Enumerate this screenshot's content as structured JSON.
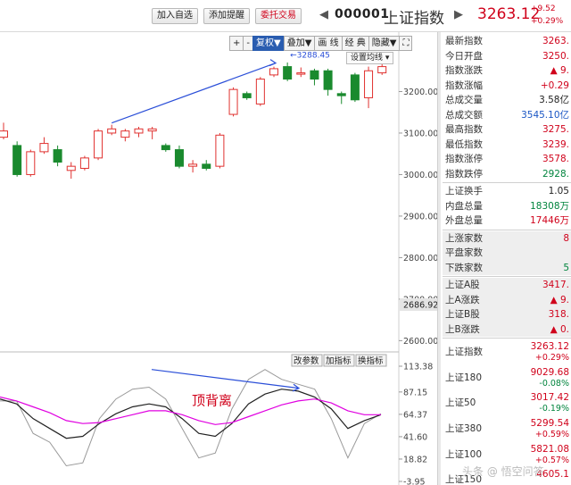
{
  "topbar": {
    "add_watchlist": "加入自选",
    "add_alert": "添加提醒",
    "trade": "委托交易",
    "code": "000001",
    "name": "上证指数",
    "price": "3263.12",
    "change": "+9.52",
    "change_pct": "+0.29%"
  },
  "toolbar": {
    "plus": "+",
    "minus": "-",
    "restore": "复权▼",
    "overlay": "叠加▼",
    "draw": "画 线",
    "classic": "经 典",
    "hide": "隐藏▼",
    "expand": "⛶",
    "ma_settings": "设置均线 ▾"
  },
  "chart_data": [
    {
      "type": "candlestick",
      "title": "",
      "y_ticks": [
        3200.0,
        3100.0,
        3000.0,
        2900.0,
        2800.0,
        2700.0,
        2600.0
      ],
      "y_highlight": "2686.92",
      "ylim": [
        2575,
        3300
      ],
      "annotation": "3288.45",
      "candles": [
        {
          "o": 3090,
          "c": 3105,
          "h": 3125,
          "l": 3085
        },
        {
          "o": 3070,
          "c": 3000,
          "h": 3080,
          "l": 2995
        },
        {
          "o": 3000,
          "c": 3055,
          "h": 3060,
          "l": 2995
        },
        {
          "o": 3055,
          "c": 3075,
          "h": 3090,
          "l": 3050
        },
        {
          "o": 3060,
          "c": 3030,
          "h": 3070,
          "l": 3020
        },
        {
          "o": 3010,
          "c": 3020,
          "h": 3030,
          "l": 2990
        },
        {
          "o": 3015,
          "c": 3040,
          "h": 3045,
          "l": 3010
        },
        {
          "o": 3040,
          "c": 3105,
          "h": 3110,
          "l": 3035
        },
        {
          "o": 3100,
          "c": 3110,
          "h": 3120,
          "l": 3095
        },
        {
          "o": 3090,
          "c": 3105,
          "h": 3110,
          "l": 3080
        },
        {
          "o": 3100,
          "c": 3110,
          "h": 3115,
          "l": 3090
        },
        {
          "o": 3105,
          "c": 3110,
          "h": 3115,
          "l": 3085
        },
        {
          "o": 3070,
          "c": 3060,
          "h": 3075,
          "l": 3055
        },
        {
          "o": 3060,
          "c": 3020,
          "h": 3070,
          "l": 3015
        },
        {
          "o": 3020,
          "c": 3025,
          "h": 3035,
          "l": 3005
        },
        {
          "o": 3025,
          "c": 3015,
          "h": 3035,
          "l": 3010
        },
        {
          "o": 3020,
          "c": 3095,
          "h": 3100,
          "l": 3015
        },
        {
          "o": 3145,
          "c": 3205,
          "h": 3210,
          "l": 3140
        },
        {
          "o": 3195,
          "c": 3185,
          "h": 3200,
          "l": 3180
        },
        {
          "o": 3170,
          "c": 3230,
          "h": 3235,
          "l": 3165
        },
        {
          "o": 3240,
          "c": 3255,
          "h": 3260,
          "l": 3235
        },
        {
          "o": 3260,
          "c": 3230,
          "h": 3270,
          "l": 3225
        },
        {
          "o": 3245,
          "c": 3245,
          "h": 3258,
          "l": 3235
        },
        {
          "o": 3250,
          "c": 3230,
          "h": 3255,
          "l": 3215
        },
        {
          "o": 3250,
          "c": 3205,
          "h": 3255,
          "l": 3190
        },
        {
          "o": 3195,
          "c": 3190,
          "h": 3200,
          "l": 3170
        },
        {
          "o": 3240,
          "c": 3180,
          "h": 3245,
          "l": 3175
        },
        {
          "o": 3185,
          "c": 3250,
          "h": 3260,
          "l": 3160
        },
        {
          "o": 3245,
          "c": 3260,
          "h": 3270,
          "l": 3240
        }
      ]
    },
    {
      "type": "line",
      "title": "",
      "y_ticks": [
        "113.38",
        "87.15",
        "64.37",
        "41.60",
        "18.82",
        "-3.95"
      ],
      "ylim": [
        -3.95,
        113.38
      ],
      "label": "顶背离",
      "buttons": [
        "改参数",
        "加指标",
        "换指标"
      ],
      "series": [
        {
          "name": "",
          "color": "#999999",
          "values": [
            78,
            78,
            45,
            36,
            12,
            15,
            60,
            80,
            90,
            92,
            80,
            50,
            20,
            25,
            70,
            100,
            110,
            100,
            95,
            90,
            60,
            20,
            55,
            65
          ]
        },
        {
          "name": "",
          "color": "#222222",
          "values": [
            80,
            75,
            60,
            50,
            40,
            42,
            55,
            65,
            72,
            75,
            72,
            60,
            45,
            42,
            55,
            75,
            85,
            90,
            88,
            82,
            70,
            50,
            58,
            64
          ]
        },
        {
          "name": "",
          "color": "#e000e0",
          "values": [
            82,
            78,
            72,
            66,
            58,
            55,
            56,
            60,
            64,
            68,
            68,
            64,
            58,
            54,
            56,
            62,
            68,
            74,
            78,
            80,
            76,
            68,
            64,
            64
          ]
        }
      ]
    }
  ],
  "panel": {
    "rows1": [
      {
        "label": "最新指数",
        "value": "3263.",
        "color": "red"
      },
      {
        "label": "今日开盘",
        "value": "3250.",
        "color": "red"
      },
      {
        "label": "指数涨跌",
        "value": "▲ 9.",
        "color": "red"
      },
      {
        "label": "指数涨幅",
        "value": "+0.29",
        "color": "red"
      },
      {
        "label": "总成交量",
        "value": "3.58亿",
        "color": "black"
      },
      {
        "label": "总成交额",
        "value": "3545.10亿",
        "color": "blue"
      },
      {
        "label": "最高指数",
        "value": "3275.",
        "color": "red"
      },
      {
        "label": "最低指数",
        "value": "3239.",
        "color": "red"
      },
      {
        "label": "指数涨停",
        "value": "3578.",
        "color": "red"
      },
      {
        "label": "指数跌停",
        "value": "2928.",
        "color": "green"
      }
    ],
    "rows2": [
      {
        "label": "上证换手",
        "value": "1.05",
        "color": "black"
      },
      {
        "label": "内盘总量",
        "value": "18308万",
        "color": "green"
      },
      {
        "label": "外盘总量",
        "value": "17446万",
        "color": "red"
      }
    ],
    "rows3": [
      {
        "label": "上涨家数",
        "value": "8",
        "color": "red"
      },
      {
        "label": "平盘家数",
        "value": "",
        "color": "black"
      },
      {
        "label": "下跌家数",
        "value": "5",
        "color": "green"
      }
    ],
    "rows4": [
      {
        "label": "上证A股",
        "value": "3417.",
        "color": "red"
      },
      {
        "label": "上A涨跌",
        "value": "▲ 9.",
        "color": "red"
      },
      {
        "label": "上证B股",
        "value": "318.",
        "color": "red"
      },
      {
        "label": "上B涨跌",
        "value": "▲ 0.",
        "color": "red"
      }
    ],
    "index_list": [
      {
        "label": "上证指数",
        "value": "3263.12",
        "pct": "+0.29%",
        "pct_color": "red"
      },
      {
        "label": "上证180",
        "value": "9029.68",
        "pct": "-0.08%",
        "pct_color": "green"
      },
      {
        "label": "上证50",
        "value": "3017.42",
        "pct": "-0.19%",
        "pct_color": "green"
      },
      {
        "label": "上证380",
        "value": "5299.54",
        "pct": "+0.59%",
        "pct_color": "red"
      },
      {
        "label": "上证100",
        "value": "5821.08",
        "pct": "+0.57%",
        "pct_color": "red"
      },
      {
        "label": "上证150",
        "value": "4605.1",
        "pct": "",
        "pct_color": "red"
      }
    ]
  },
  "watermark": "头条 @ 悟空问答"
}
